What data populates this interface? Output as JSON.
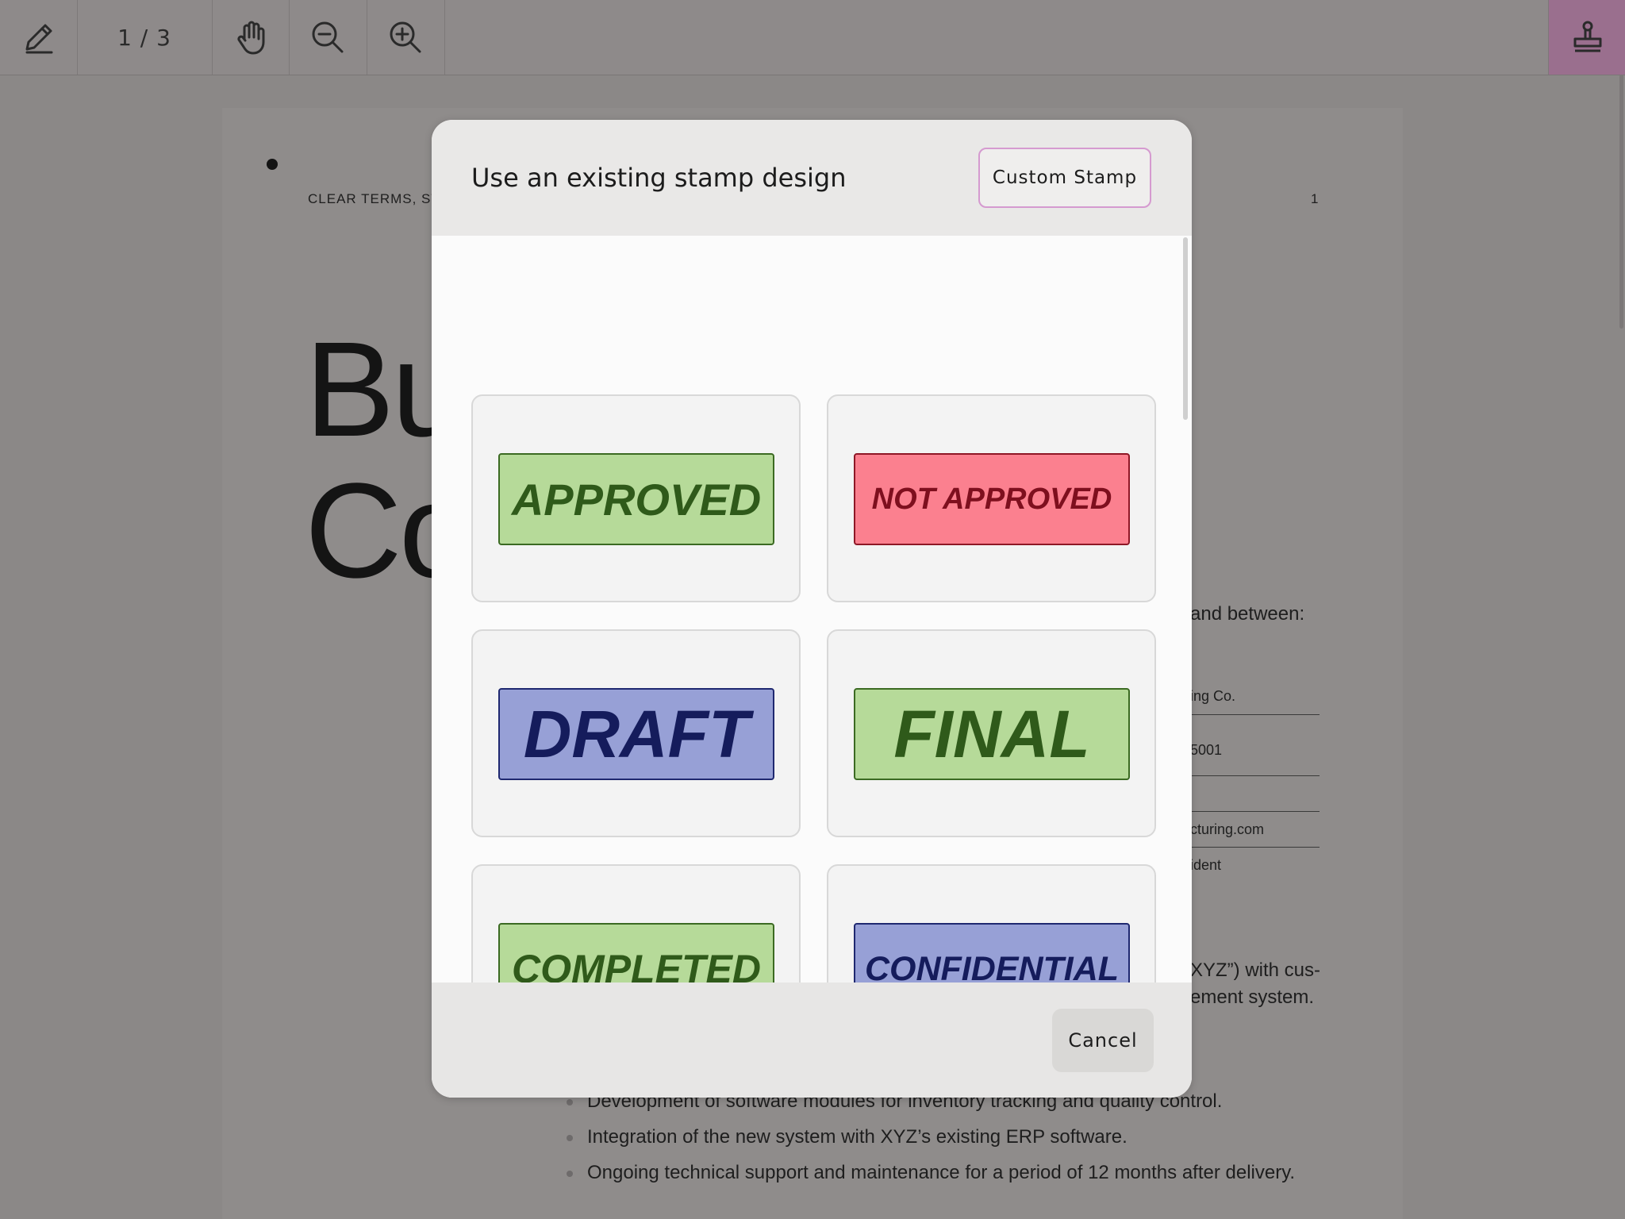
{
  "toolbar": {
    "page_indicator": "1 / 3",
    "icons": [
      "pen-icon",
      "hand-icon",
      "zoom-out-icon",
      "zoom-in-icon",
      "stamp-icon"
    ],
    "active_color": "#9a6f8e"
  },
  "document": {
    "header_left": "CLEAR TERMS, ST",
    "header_right": "1",
    "title_line1": "Bu",
    "title_line2": "Co",
    "fragments": [
      "and between:",
      "ing Co.",
      "5001",
      "cturing.com",
      "ident",
      "XYZ”) with cus-",
      "ement system."
    ],
    "bullets": [
      "Development of software modules for inventory tracking and quality control.",
      "Integration of the new system with XYZ’s existing ERP software.",
      "Ongoing technical support and maintenance for a period of 12 months after delivery."
    ]
  },
  "modal": {
    "title": "Use an existing stamp design",
    "custom_stamp_label": "Custom Stamp",
    "cancel_label": "Cancel",
    "stamps": [
      {
        "label": "APPROVED",
        "bg": "#b6da99",
        "border": "#3b6a22",
        "text_color": "#2f5a1a"
      },
      {
        "label": "NOT APPROVED",
        "bg": "#fb808f",
        "border": "#8e1726",
        "text_color": "#7e0f1e"
      },
      {
        "label": "DRAFT",
        "bg": "#97a0d6",
        "border": "#1f2870",
        "text_color": "#151c5c"
      },
      {
        "label": "FINAL",
        "bg": "#b6da99",
        "border": "#3b6a22",
        "text_color": "#2f5a1a"
      },
      {
        "label": "COMPLETED",
        "bg": "#b6da99",
        "border": "#3b6a22",
        "text_color": "#2f5a1a"
      },
      {
        "label": "CONFIDENTIAL",
        "bg": "#97a0d6",
        "border": "#1f2870",
        "text_color": "#151c5c"
      }
    ]
  }
}
